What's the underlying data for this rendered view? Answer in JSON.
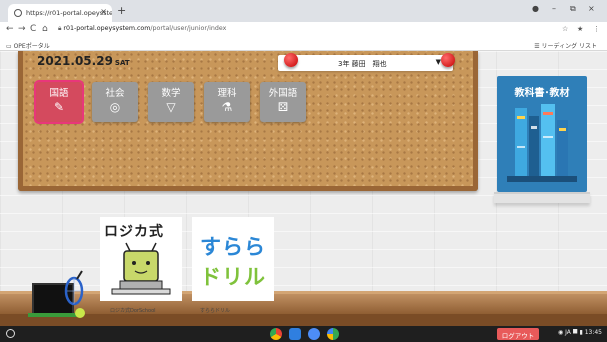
{
  "browser": {
    "tab_title": "https://r01-portal.opeysstem...",
    "tab_close": "×",
    "new_tab": "+",
    "window_controls": [
      "●",
      "–",
      "⧉",
      "×"
    ],
    "nav": [
      "←",
      "→",
      "C",
      "⌂"
    ],
    "url_host": "r01-portal.opeysystem.com",
    "url_path": "/portal/user/junior/index",
    "toolbar_icons": [
      "☆",
      "★",
      "⋮"
    ],
    "bookmark_left": "OPEポータル",
    "bookmark_right": "リーディング リスト"
  },
  "board": {
    "date": "2021.05.29",
    "day_of_week": "SAT",
    "user": "3年 藤田　翔也",
    "user_caret": "▼",
    "subjects": [
      {
        "label": "国語",
        "icon": "✎",
        "color": "#d44a5e",
        "active": true
      },
      {
        "label": "社会",
        "icon": "◎",
        "color": "#9a9a9a",
        "active": false
      },
      {
        "label": "数学",
        "icon": "▽",
        "color": "#9a9a9a",
        "active": false
      },
      {
        "label": "理科",
        "icon": "⚗",
        "color": "#9a9a9a",
        "active": false
      },
      {
        "label": "外国語",
        "icon": "⚄",
        "color": "#9a9a9a",
        "active": false
      }
    ]
  },
  "textbooks": {
    "title": "教科書･教材"
  },
  "apps": [
    {
      "title": "ロジカ式",
      "label": "ロジカ式DorSchool"
    },
    {
      "title_line1": "すらら",
      "title_line2": "ドリル",
      "label": "すららドリル"
    }
  ],
  "taskbar": {
    "logout": "ログアウト",
    "tray": "JA  ⯀  ▮  13:45",
    "tray_icon": "◉"
  },
  "colors": {
    "cork": "#c8975a",
    "frame": "#9a6636",
    "textbook_blue": "#2f7fb8",
    "logout_red": "#e85a5a",
    "surara_blue": "#2b87d6",
    "surara_green": "#7fc23b"
  }
}
